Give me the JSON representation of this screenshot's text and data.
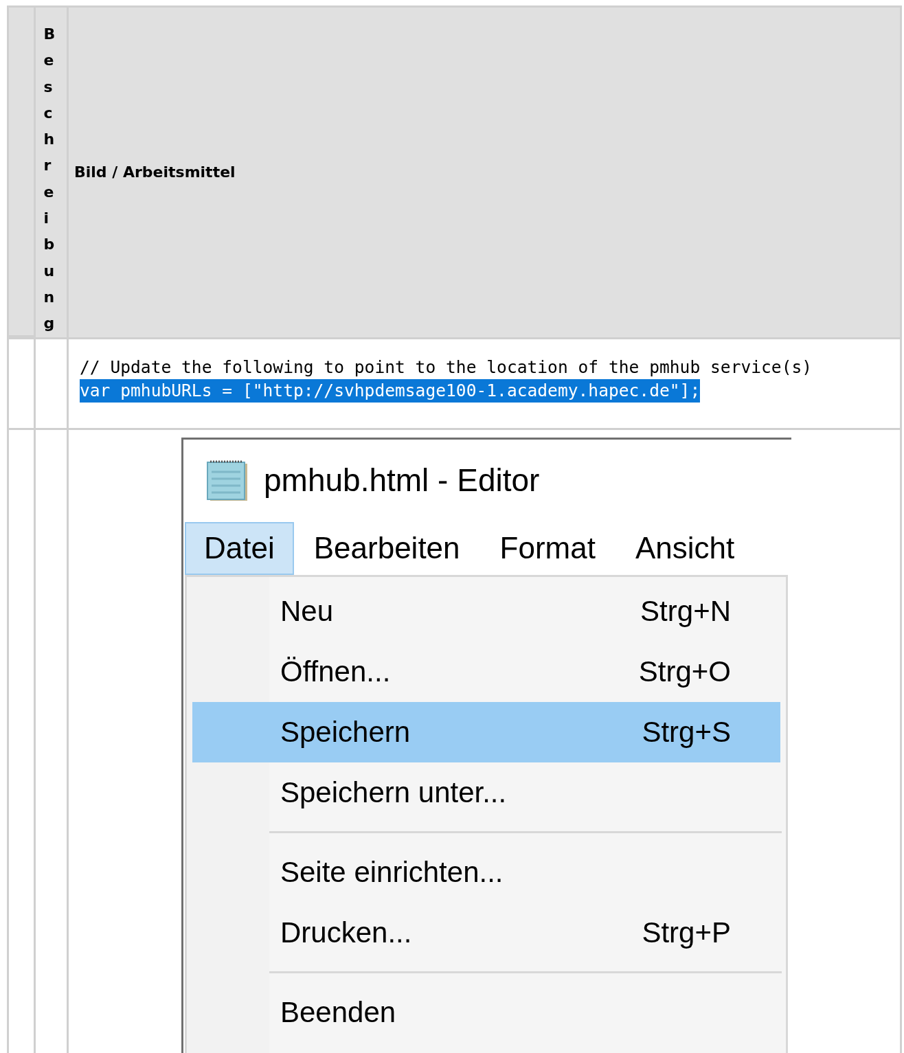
{
  "table": {
    "header": {
      "column_2": "Beschreibung",
      "column_3": "Bild / Arbeitsmittel"
    },
    "code_row": {
      "lines": [
        {
          "text": "// Update the following to point to the location of the pmhub service(s)",
          "selected": false
        },
        {
          "text": "var pmhubURLs = [\"http://svhpdemsage100-1.academy.hapec.de\"];",
          "selected": true
        }
      ]
    },
    "screenshot_row": {
      "window": {
        "title": "pmhub.html - Editor"
      },
      "menu_bar": [
        {
          "label": "Datei",
          "selected": true
        },
        {
          "label": "Bearbeiten",
          "selected": false
        },
        {
          "label": "Format",
          "selected": false
        },
        {
          "label": "Ansicht",
          "selected": false
        }
      ],
      "menu": [
        {
          "kind": "item",
          "label": "Neu",
          "shortcut": "Strg+N",
          "selected": false
        },
        {
          "kind": "item",
          "label": "Öffnen...",
          "shortcut": "Strg+O",
          "selected": false
        },
        {
          "kind": "item",
          "label": "Speichern",
          "shortcut": "Strg+S",
          "selected": true
        },
        {
          "kind": "item",
          "label": "Speichern unter...",
          "selected": false
        },
        {
          "kind": "separator"
        },
        {
          "kind": "item",
          "label": "Seite einrichten...",
          "selected": false
        },
        {
          "kind": "item",
          "label": "Drucken...",
          "shortcut": "Strg+P",
          "selected": false
        },
        {
          "kind": "separator"
        },
        {
          "kind": "item",
          "label": "Beenden",
          "selected": false
        }
      ]
    }
  }
}
